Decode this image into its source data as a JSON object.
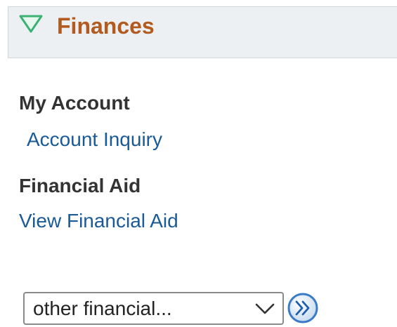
{
  "finances": {
    "title": "Finances",
    "toggle_icon": "triangle-down-icon",
    "accent_color": "#b35a1f",
    "toggle_color": "#3bb273"
  },
  "my_account": {
    "heading": "My Account",
    "links": [
      "Account Inquiry"
    ]
  },
  "financial_aid": {
    "heading": "Financial Aid",
    "links": [
      "View Financial Aid"
    ]
  },
  "other_financial": {
    "selected_value": "other financial...",
    "chevron_icon": "chevron-down-icon",
    "go_icon": "double-chevron-right-icon",
    "link_color": "#1a5a99"
  }
}
